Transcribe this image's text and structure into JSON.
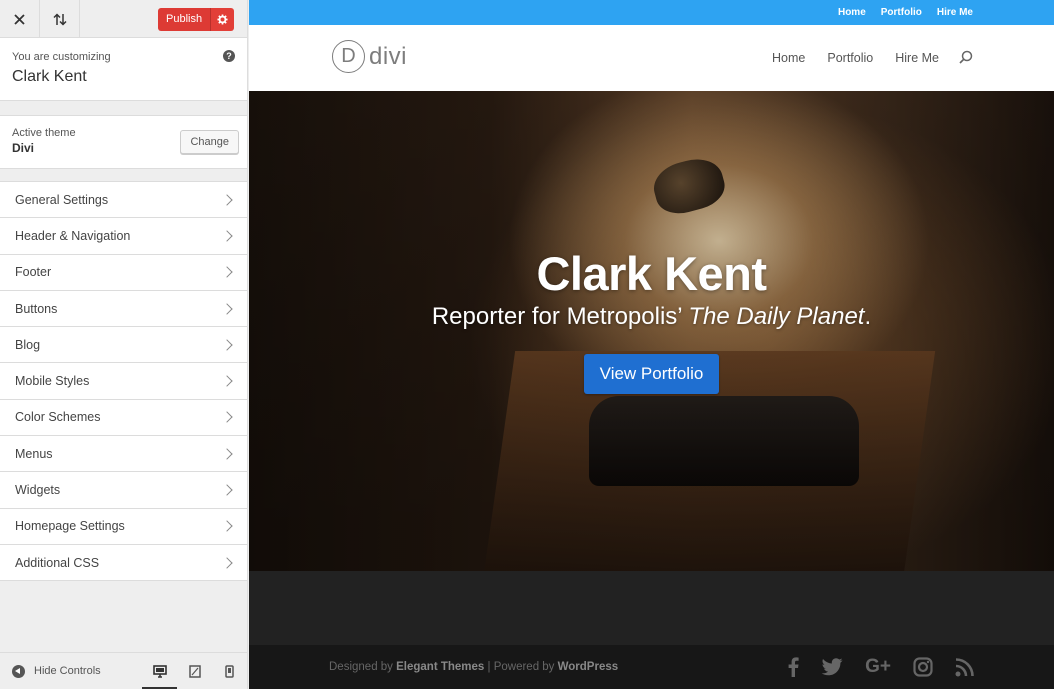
{
  "customizer": {
    "publish_label": "Publish",
    "customizing_label": "You are customizing",
    "site_title": "Clark Kent",
    "active_theme_label": "Active theme",
    "active_theme": "Divi",
    "change_label": "Change",
    "menu_items": [
      "General Settings",
      "Header & Navigation",
      "Footer",
      "Buttons",
      "Blog",
      "Mobile Styles",
      "Color Schemes",
      "Menus",
      "Widgets",
      "Homepage Settings",
      "Additional CSS"
    ],
    "hide_controls_label": "Hide Controls"
  },
  "preview": {
    "secondary_nav": [
      "Home",
      "Portfolio",
      "Hire Me"
    ],
    "logo_letter": "D",
    "logo_text": "divi",
    "main_nav": [
      "Home",
      "Portfolio",
      "Hire Me"
    ],
    "hero": {
      "title": "Clark Kent",
      "tagline_prefix": "Reporter for Metropolis’ ",
      "tagline_italic": "The Daily Planet",
      "tagline_suffix": ".",
      "button_label": "View Portfolio"
    },
    "footer": {
      "designed_by": "Designed by ",
      "designer": "Elegant Themes",
      "separator": " | Powered by ",
      "platform": "WordPress",
      "social_icons": [
        "facebook-icon",
        "twitter-icon",
        "google-plus-icon",
        "instagram-icon",
        "rss-icon"
      ],
      "gplus_text": "G+"
    }
  },
  "colors": {
    "publish": "#dd3a34",
    "topbar_blue": "#2ea3f2",
    "cta_blue": "#1f6fd1"
  }
}
